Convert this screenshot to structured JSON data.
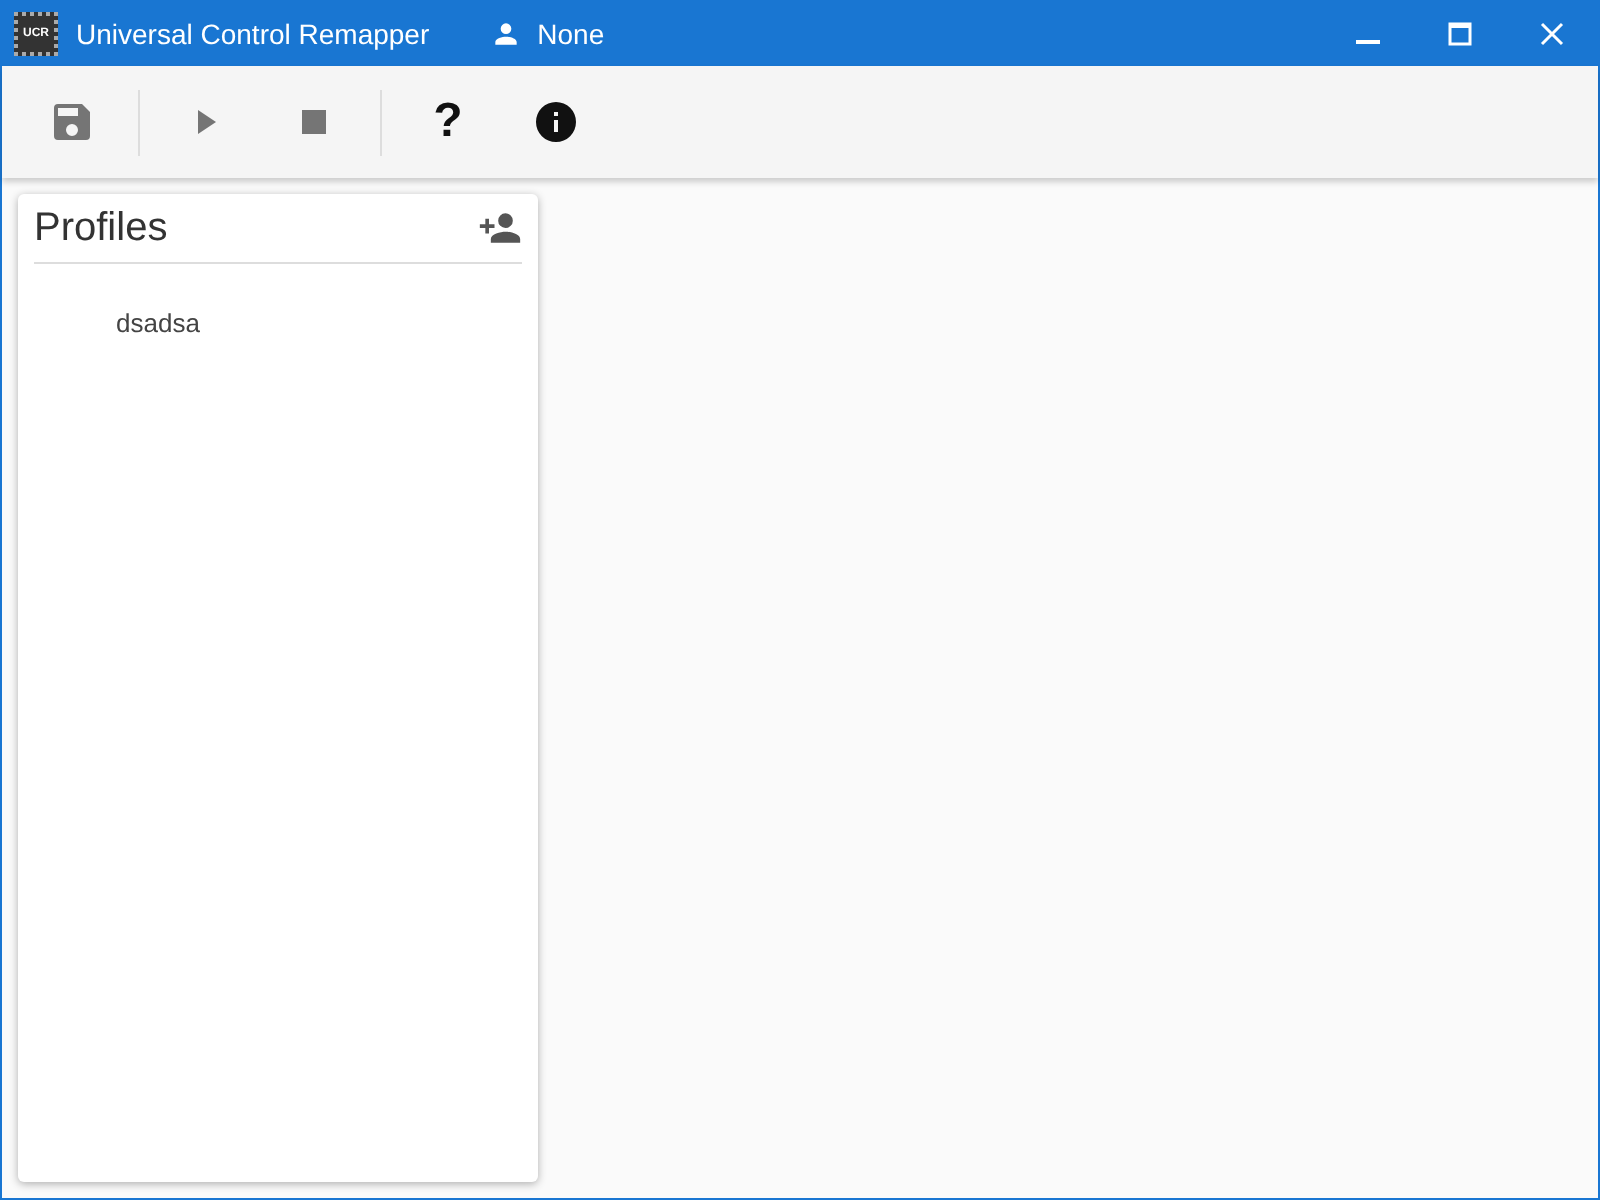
{
  "window": {
    "logo_text": "UCR",
    "title": "Universal Control Remapper",
    "profile": "None"
  },
  "toolbar": [
    {
      "kind": "save",
      "disabled": true
    },
    {
      "kind": "separator"
    },
    {
      "kind": "play",
      "disabled": true
    },
    {
      "kind": "stop",
      "disabled": true
    },
    {
      "kind": "separator"
    },
    {
      "kind": "help",
      "label": "?",
      "disabled": false
    },
    {
      "kind": "info",
      "disabled": false
    }
  ],
  "profiles_panel": {
    "title": "Profiles",
    "items": [
      {
        "label": "dsadsa"
      }
    ]
  }
}
